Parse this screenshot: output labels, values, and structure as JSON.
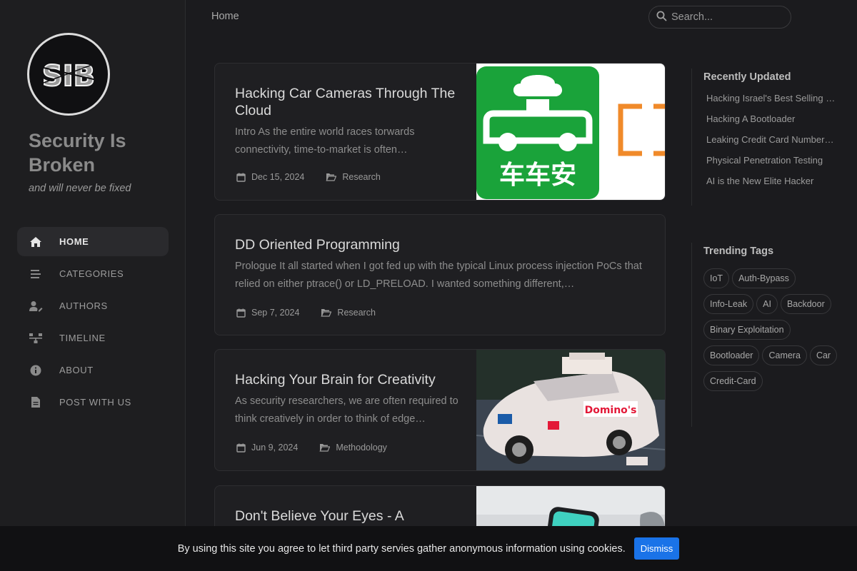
{
  "sidebar": {
    "site_title": "Security Is Broken",
    "subtitle": "and will never be fixed",
    "nav": [
      {
        "label": "HOME",
        "icon": "home-icon"
      },
      {
        "label": "CATEGORIES",
        "icon": "stream-icon"
      },
      {
        "label": "AUTHORS",
        "icon": "user-edit-icon"
      },
      {
        "label": "TIMELINE",
        "icon": "timeline-icon"
      },
      {
        "label": "ABOUT",
        "icon": "info-icon"
      },
      {
        "label": "POST WITH US",
        "icon": "document-icon"
      }
    ]
  },
  "topbar": {
    "breadcrumb": "Home",
    "search_placeholder": "Search..."
  },
  "posts": [
    {
      "title": "Hacking Car Cameras Through The Cloud",
      "excerpt": "Intro As the entire world races torwards connectivity, time-to-market is often…",
      "date": "Dec 15, 2024",
      "category": "Research",
      "image_text": "车车安"
    },
    {
      "title": "DD Oriented Programming",
      "excerpt": "Prologue It all started when I got fed up with the typical Linux process injection PoCs that relied on either ptrace() or LD_PRELOAD. I wanted something different,…",
      "date": "Sep 7, 2024",
      "category": "Research"
    },
    {
      "title": "Hacking Your Brain for Creativity",
      "excerpt": "As security researchers, we are often required to think creatively in order to think of edge…",
      "date": "Jun 9, 2024",
      "category": "Methodology",
      "image_text": "Domino's"
    },
    {
      "title": "Don't Believe Your Eyes - A WhatsApp Phishing Vulnerability"
    }
  ],
  "recently_updated": {
    "title": "Recently Updated",
    "items": [
      "Hacking Israel's Best Selling …",
      "Hacking A Bootloader",
      "Leaking Credit Card Number…",
      "Physical Penetration Testing",
      "AI is the New Elite Hacker"
    ]
  },
  "trending_tags": {
    "title": "Trending Tags",
    "tags": [
      "IoT",
      "Auth-Bypass",
      "Info-Leak",
      "AI",
      "Backdoor",
      "Binary Exploitation",
      "Bootloader",
      "Camera",
      "Car",
      "Credit-Card"
    ]
  },
  "cookie": {
    "text": "By using this site you agree to let third party servies gather anonymous information using cookies.",
    "button": "Dismiss"
  },
  "colors": {
    "background": "#1b1b1e",
    "accent": "#1a73e8",
    "image_green": "#1aa33a",
    "image_orange": "#f08a2a"
  }
}
